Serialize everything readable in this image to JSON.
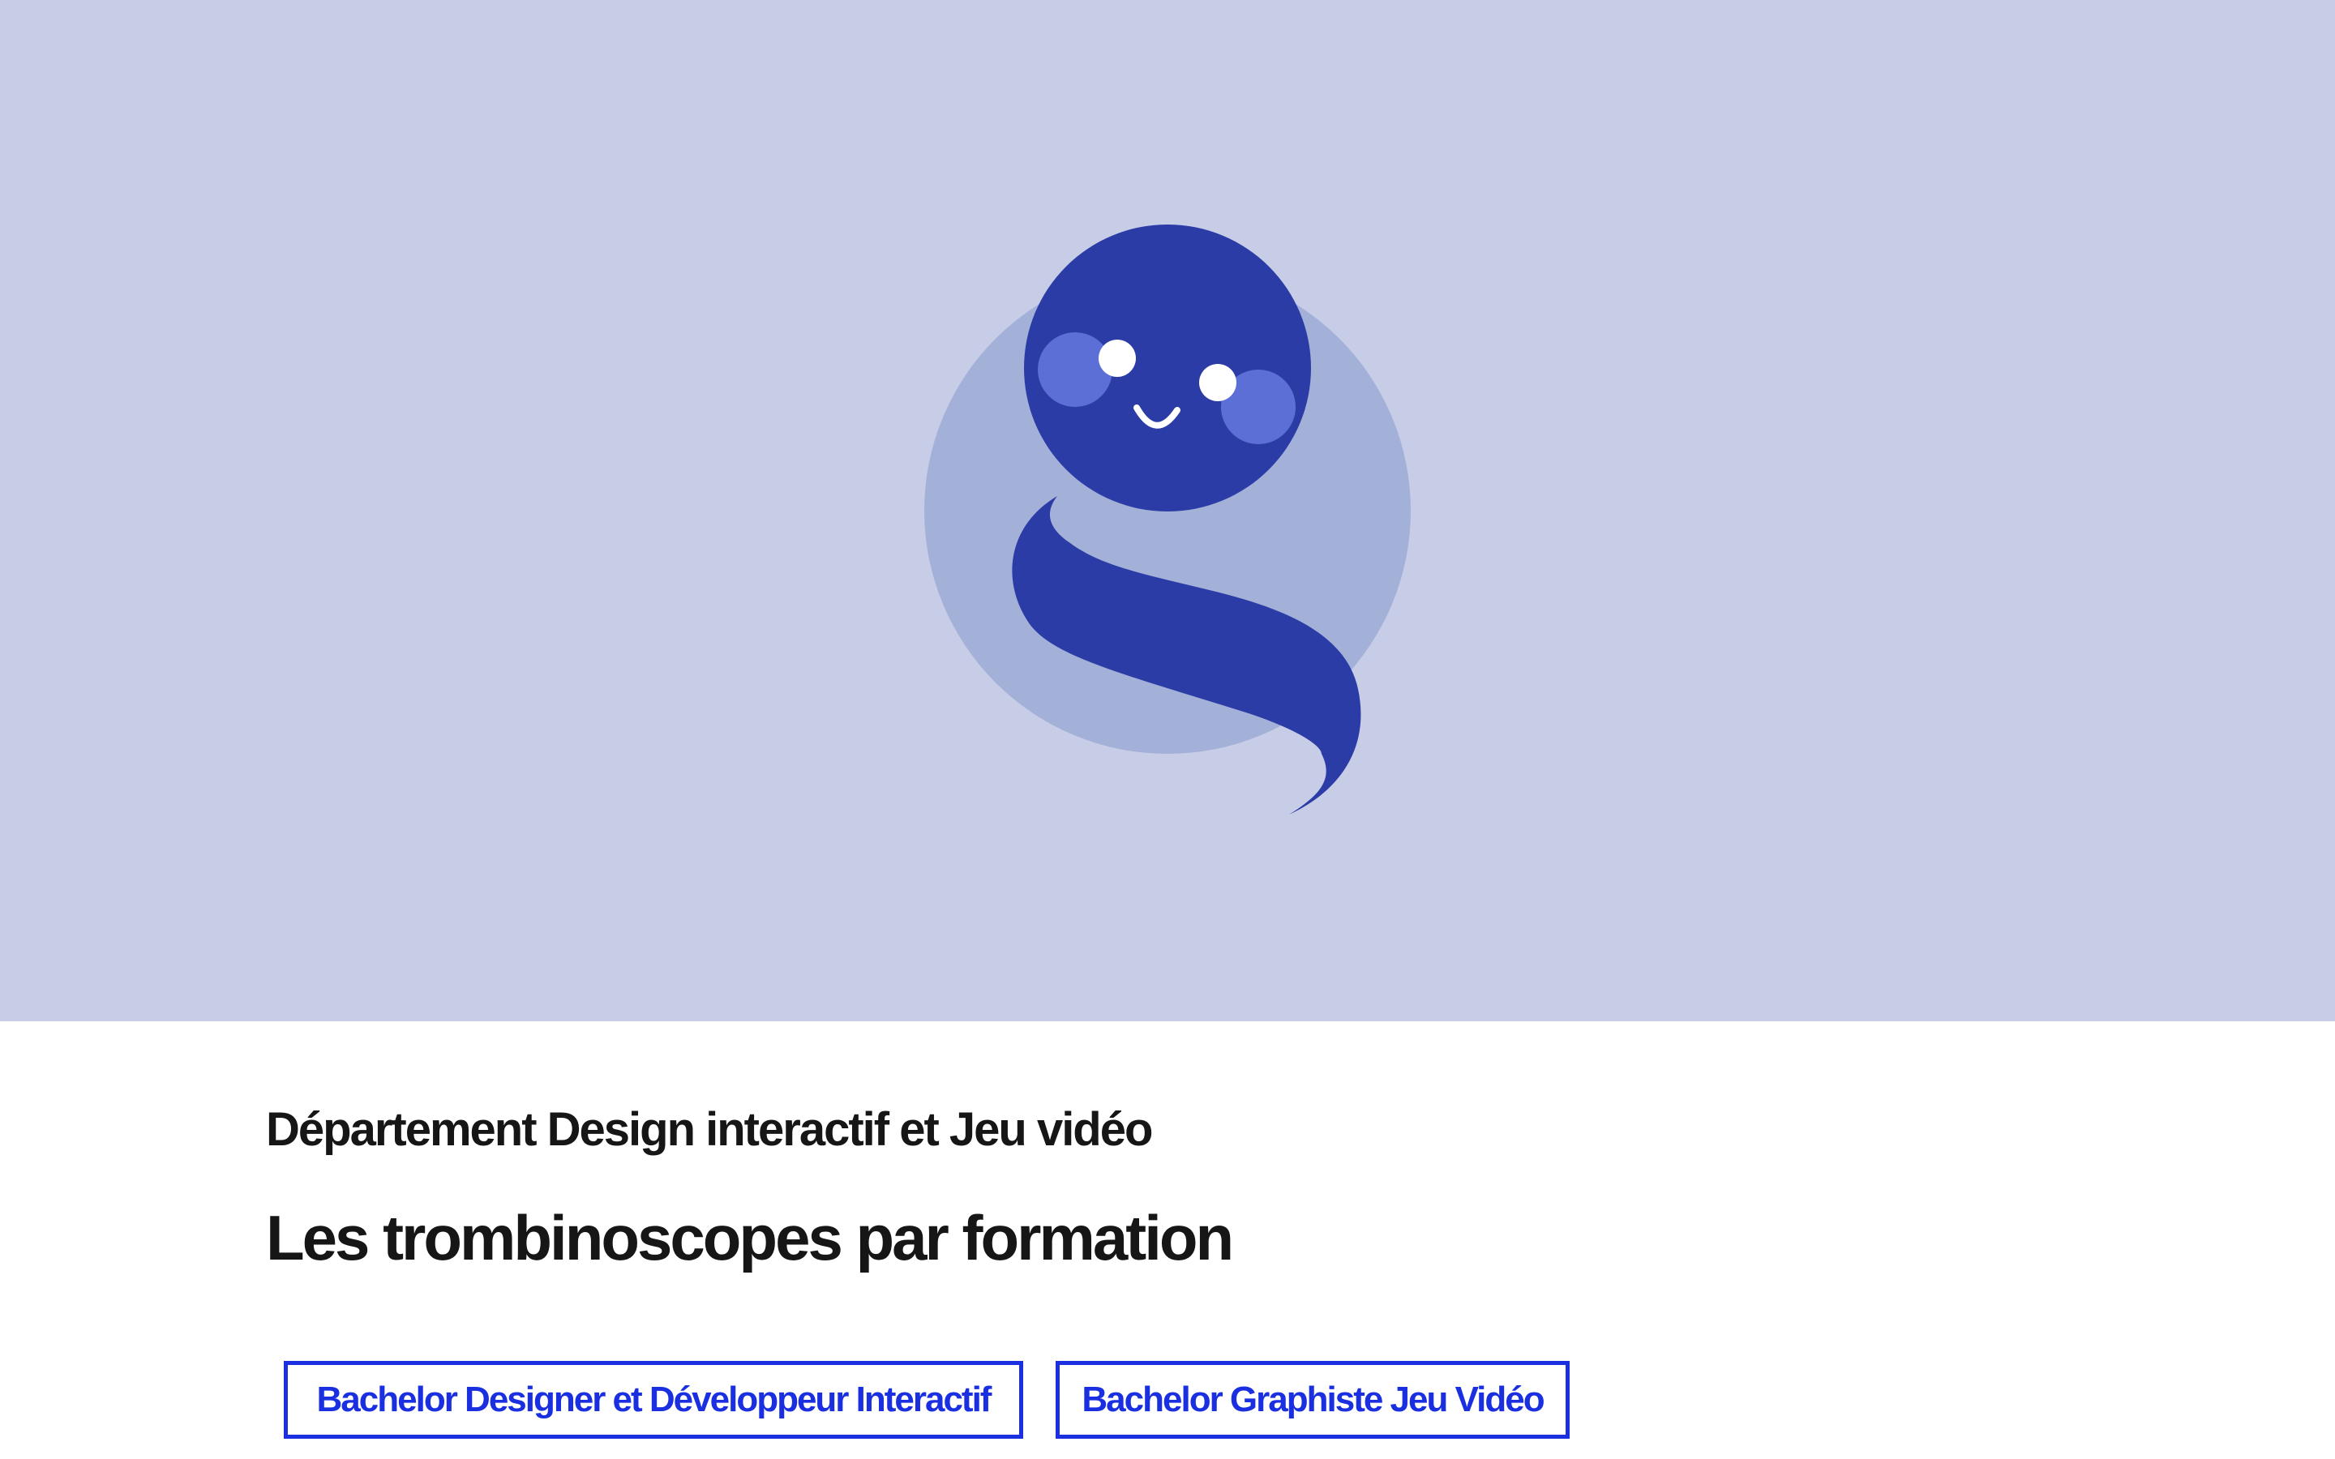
{
  "colors": {
    "hero_background": "#c8cde7",
    "mascot_halo": "#a3b0d8",
    "mascot_body": "#2b3ca6",
    "mascot_cheek": "#5b6fd6",
    "accent_blue": "#1a2fe0",
    "heading_text": "#161616"
  },
  "hero": {
    "illustration": "mascot-icon"
  },
  "section": {
    "department": "Département Design interactif et Jeu vidéo",
    "title": "Les trombinoscopes par formation"
  },
  "formations": [
    {
      "label": "Bachelor Designer et Développeur Interactif"
    },
    {
      "label": "Bachelor Graphiste Jeu Vidéo"
    }
  ]
}
